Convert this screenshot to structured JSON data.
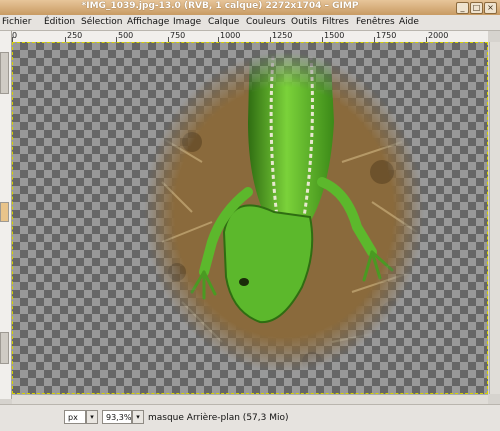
{
  "window": {
    "title": "*IMG_1039.jpg-13.0 (RVB, 1 calque) 2272x1704 – GIMP",
    "buttons": [
      "_",
      "□",
      "×"
    ]
  },
  "menu": [
    {
      "label": "Fichier"
    },
    {
      "label": "Édition"
    },
    {
      "label": "Sélection"
    },
    {
      "label": "Affichage"
    },
    {
      "label": "Image"
    },
    {
      "label": "Calque"
    },
    {
      "label": "Couleurs"
    },
    {
      "label": "Outils"
    },
    {
      "label": "Filtres"
    },
    {
      "label": "Fenêtres"
    },
    {
      "label": "Aide"
    }
  ],
  "ruler": {
    "labels": [
      "0",
      "250",
      "500",
      "750",
      "1000",
      "1250",
      "1500",
      "1750",
      "2000"
    ]
  },
  "status": {
    "unit": "px",
    "unit_arrow": "▾",
    "zoom": "93,3%",
    "zoom_arrow": "▾",
    "layer_text": "masque Arrière-plan (57,3 Mio)"
  },
  "colors": {
    "lizard": "#5cb82c",
    "lizard_dark": "#2f6d12",
    "ground": "#8a6a3c"
  }
}
